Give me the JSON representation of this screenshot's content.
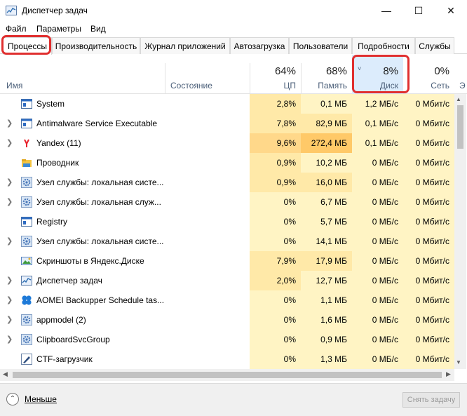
{
  "window": {
    "title": "Диспетчер задач",
    "minimize_glyph": "—",
    "maximize_glyph": "☐",
    "close_glyph": "✕"
  },
  "menu": [
    "Файл",
    "Параметры",
    "Вид"
  ],
  "tabs": [
    {
      "label": "Процессы",
      "active": true
    },
    {
      "label": "Производительность",
      "active": false
    },
    {
      "label": "Журнал приложений",
      "active": false
    },
    {
      "label": "Автозагрузка",
      "active": false
    },
    {
      "label": "Пользователи",
      "active": false
    },
    {
      "label": "Подробности",
      "active": false
    },
    {
      "label": "Службы",
      "active": false
    }
  ],
  "columns": {
    "name": "Имя",
    "status": "Состояние",
    "cpu": {
      "percent": "64%",
      "label": "ЦП"
    },
    "memory": {
      "percent": "68%",
      "label": "Память"
    },
    "disk": {
      "percent": "8%",
      "label": "Диск"
    },
    "network": {
      "percent": "0%",
      "label": "Сеть"
    },
    "next_cut": "Э"
  },
  "processes": [
    {
      "name": "System",
      "expandable": false,
      "icon": "system-window-icon",
      "cpu": "2,8%",
      "memory": "0,1 МБ",
      "disk": "1,2 МБ/с",
      "network": "0 Мбит/с"
    },
    {
      "name": "Antimalware Service Executable",
      "expandable": true,
      "icon": "system-window-icon",
      "cpu": "7,8%",
      "memory": "82,9 МБ",
      "disk": "0,1 МБ/с",
      "network": "0 Мбит/с"
    },
    {
      "name": "Yandex (11)",
      "expandable": true,
      "icon": "yandex-browser-icon",
      "cpu": "9,6%",
      "memory": "272,4 МБ",
      "disk": "0,1 МБ/с",
      "network": "0 Мбит/с"
    },
    {
      "name": "Проводник",
      "expandable": false,
      "icon": "explorer-folder-icon",
      "cpu": "0,9%",
      "memory": "10,2 МБ",
      "disk": "0 МБ/с",
      "network": "0 Мбит/с"
    },
    {
      "name": "Узел службы: локальная систе...",
      "expandable": true,
      "icon": "service-gear-icon",
      "cpu": "0,9%",
      "memory": "16,0 МБ",
      "disk": "0 МБ/с",
      "network": "0 Мбит/с"
    },
    {
      "name": "Узел службы: локальная служ...",
      "expandable": true,
      "icon": "service-gear-icon",
      "cpu": "0%",
      "memory": "6,7 МБ",
      "disk": "0 МБ/с",
      "network": "0 Мбит/с"
    },
    {
      "name": "Registry",
      "expandable": false,
      "icon": "system-window-icon",
      "cpu": "0%",
      "memory": "5,7 МБ",
      "disk": "0 МБ/с",
      "network": "0 Мбит/с"
    },
    {
      "name": "Узел службы: локальная систе...",
      "expandable": true,
      "icon": "service-gear-icon",
      "cpu": "0%",
      "memory": "14,1 МБ",
      "disk": "0 МБ/с",
      "network": "0 Мбит/с"
    },
    {
      "name": "Скриншоты в Яндекс.Диске",
      "expandable": false,
      "icon": "yandex-disk-screenshot-icon",
      "cpu": "7,9%",
      "memory": "17,9 МБ",
      "disk": "0 МБ/с",
      "network": "0 Мбит/с"
    },
    {
      "name": "Диспетчер задач",
      "expandable": true,
      "icon": "task-manager-icon",
      "cpu": "2,0%",
      "memory": "12,7 МБ",
      "disk": "0 МБ/с",
      "network": "0 Мбит/с"
    },
    {
      "name": "AOMEI Backupper Schedule tas...",
      "expandable": true,
      "icon": "aomei-icon",
      "cpu": "0%",
      "memory": "1,1 МБ",
      "disk": "0 МБ/с",
      "network": "0 Мбит/с"
    },
    {
      "name": "appmodel (2)",
      "expandable": true,
      "icon": "service-gear-icon",
      "cpu": "0%",
      "memory": "1,6 МБ",
      "disk": "0 МБ/с",
      "network": "0 Мбит/с"
    },
    {
      "name": "ClipboardSvcGroup",
      "expandable": true,
      "icon": "service-gear-icon",
      "cpu": "0%",
      "memory": "0,9 МБ",
      "disk": "0 МБ/с",
      "network": "0 Мбит/с"
    },
    {
      "name": "CTF-загрузчик",
      "expandable": false,
      "icon": "ctf-pen-icon",
      "cpu": "0%",
      "memory": "1,3 МБ",
      "disk": "0 МБ/с",
      "network": "0 Мбит/с"
    }
  ],
  "footer": {
    "less_label": "Меньше",
    "end_task_label": "Снять задачу"
  },
  "colors": {
    "highlight_border": "#e02f2f",
    "disk_header_bg": "#dcecfc",
    "heat_low": "#fff4c4",
    "heat_mid": "#ffe9a8",
    "heat_high": "#ffc968"
  }
}
